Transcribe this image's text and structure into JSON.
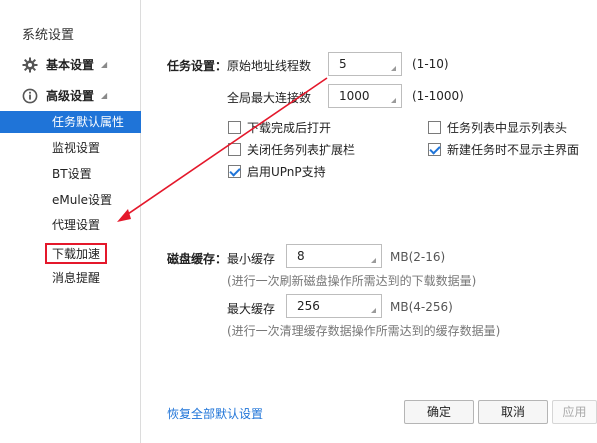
{
  "sidebar": {
    "title": "系统设置",
    "basic_group": "基本设置",
    "advanced_group": "高级设置",
    "items": [
      {
        "label": "任务默认属性"
      },
      {
        "label": "监视设置"
      },
      {
        "label": "BT设置"
      },
      {
        "label": "eMule设置"
      },
      {
        "label": "代理设置"
      },
      {
        "label": "下载加速"
      },
      {
        "label": "消息提醒"
      }
    ]
  },
  "task": {
    "section_label": "任务设置：",
    "threads_label": "原始地址线程数",
    "threads_value": "5",
    "threads_range": "(1-10)",
    "maxconn_label": "全局最大连接数",
    "maxconn_value": "1000",
    "maxconn_range": "(1-1000)",
    "checkboxes": [
      {
        "label": "下载完成后打开",
        "checked": false
      },
      {
        "label": "任务列表中显示列表头",
        "checked": false
      },
      {
        "label": "关闭任务列表扩展栏",
        "checked": false
      },
      {
        "label": "新建任务时不显示主界面",
        "checked": true
      },
      {
        "label": "启用UPnP支持",
        "checked": true
      }
    ]
  },
  "cache": {
    "section_label": "磁盘缓存：",
    "min_label": "最小缓存",
    "min_value": "8",
    "min_range": "MB(2-16)",
    "min_hint": "(进行一次刷新磁盘操作所需达到的下载数据量)",
    "max_label": "最大缓存",
    "max_value": "256",
    "max_range": "MB(4-256)",
    "max_hint": "(进行一次清理缓存数据操作所需达到的缓存数据量)"
  },
  "footer": {
    "restore_link": "恢复全部默认设置",
    "ok_label": "确定",
    "cancel_label": "取消",
    "apply_label": "应用"
  },
  "colors": {
    "accent": "#1f74d8",
    "annotation": "#e4182b"
  }
}
